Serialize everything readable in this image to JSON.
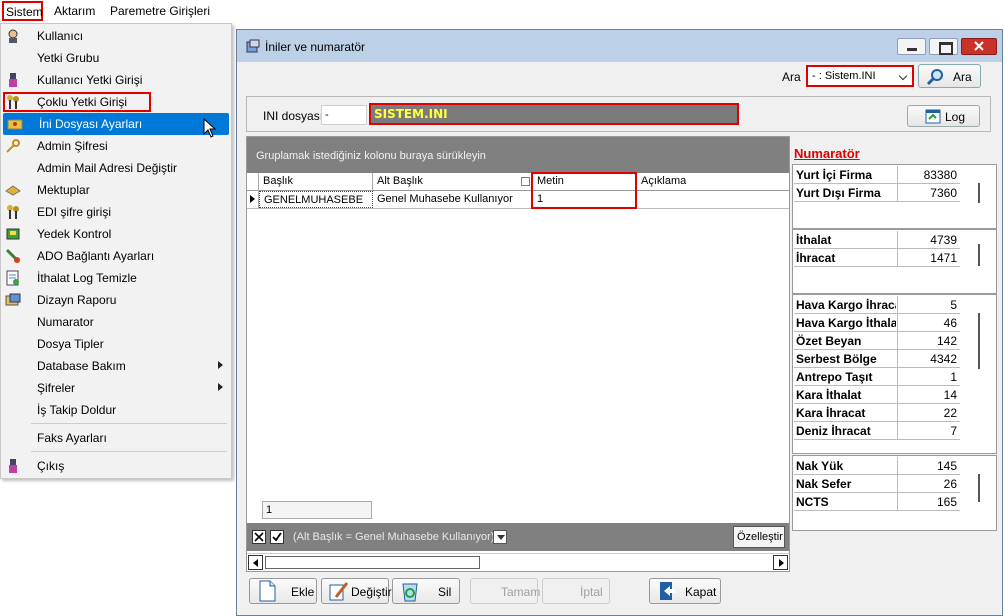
{
  "menubar": {
    "items": [
      "Sistem",
      "Aktarım",
      "Paremetre Girişleri"
    ]
  },
  "dropdown": {
    "items": [
      {
        "label": "Kullanıcı",
        "icon": "user-icon"
      },
      {
        "label": "Yetki Grubu",
        "icon": ""
      },
      {
        "label": "Kullanıcı Yetki Girişi",
        "icon": "user-key-icon"
      },
      {
        "label": "Çoklu Yetki Girişi",
        "icon": "multi-key-icon"
      },
      {
        "label": "İni Dosyası  Ayarları",
        "icon": "ini-file-icon"
      },
      {
        "label": "Admin Şifresi",
        "icon": "key-icon"
      },
      {
        "label": "Admin Mail Adresi Değiştir",
        "icon": ""
      },
      {
        "label": "Mektuplar",
        "icon": "letters-icon"
      },
      {
        "label": "EDI şifre girişi",
        "icon": "edi-key-icon"
      },
      {
        "label": "Yedek Kontrol",
        "icon": "backup-icon"
      },
      {
        "label": "ADO Bağlantı Ayarları",
        "icon": "connection-icon"
      },
      {
        "label": "İthalat Log Temizle",
        "icon": "log-clean-icon"
      },
      {
        "label": "Dizayn Raporu",
        "icon": "report-icon"
      },
      {
        "label": "Numarator",
        "icon": ""
      },
      {
        "label": "Dosya Tipler",
        "icon": ""
      },
      {
        "label": "Database Bakım",
        "icon": "",
        "submenu": true
      },
      {
        "label": "Şifreler",
        "icon": "",
        "submenu": true
      },
      {
        "label": "İş Takip Doldur",
        "icon": ""
      },
      {
        "label": "Faks Ayarları",
        "icon": ""
      },
      {
        "label": "Çıkış",
        "icon": "exit-icon"
      }
    ]
  },
  "window": {
    "title": "İniler ve numaratör"
  },
  "search": {
    "label": "Ara",
    "selected": "- : Sistem.INI",
    "button": "Ara"
  },
  "ini": {
    "label": "INI dosyası",
    "dash": "-",
    "name": "SISTEM.INI",
    "log_button": "Log"
  },
  "grid": {
    "group_hint": "Gruplamak istediğiniz kolonu buraya sürükleyin",
    "columns": [
      "Başlık",
      "Alt Başlık",
      "Metin",
      "Açıklama"
    ],
    "rows": [
      {
        "baslik": "GENELMUHASEBE",
        "alt": "Genel Muhasebe Kullanıyor",
        "metin": "1",
        "aciklama": ""
      }
    ],
    "footer": "1",
    "filter_text": "(Alt Başlık = Genel Muhasebe Kullanıyor)",
    "customize": "Özelleştir"
  },
  "numarator": {
    "title": "Numaratör",
    "groups": [
      [
        {
          "label": "Yurt İçi Firma",
          "value": "83380"
        },
        {
          "label": "Yurt Dışı Firma",
          "value": "7360"
        }
      ],
      [
        {
          "label": "İthalat",
          "value": "4739"
        },
        {
          "label": "İhracat",
          "value": "1471"
        }
      ],
      [
        {
          "label": "Hava Kargo İhracat",
          "value": "5"
        },
        {
          "label": "Hava Kargo İthalat",
          "value": "46"
        },
        {
          "label": "Özet Beyan",
          "value": "142"
        },
        {
          "label": "Serbest Bölge",
          "value": "4342"
        },
        {
          "label": "Antrepo Taşıt",
          "value": "1"
        },
        {
          "label": "Kara İthalat",
          "value": "14"
        },
        {
          "label": "Kara İhracat",
          "value": "22"
        },
        {
          "label": "Deniz İhracat",
          "value": "7"
        }
      ],
      [
        {
          "label": "Nak Yük",
          "value": "145"
        },
        {
          "label": "Nak Sefer",
          "value": "26"
        },
        {
          "label": "NCTS",
          "value": "165"
        }
      ]
    ]
  },
  "buttons": {
    "ekle": "Ekle",
    "degistir": "Değiştir",
    "sil": "Sil",
    "tamam": "Tamam",
    "iptal": "İptal",
    "kapat": "Kapat"
  }
}
